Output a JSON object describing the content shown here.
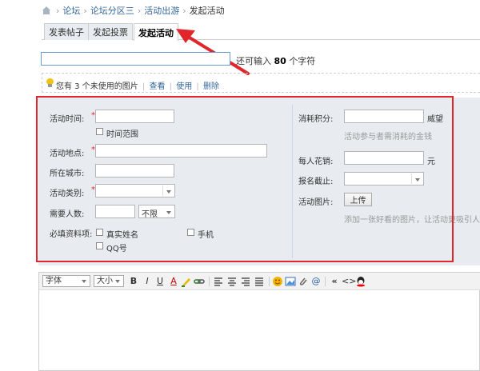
{
  "breadcrumb": [
    "论坛",
    "论坛分区三",
    "活动出游",
    "发起活动"
  ],
  "tabs": [
    "发表帖子",
    "发起投票",
    "发起活动"
  ],
  "subject": {
    "value": "",
    "remaining_prefix": "还可输入",
    "remaining_count": "80",
    "remaining_suffix": "个字符"
  },
  "attach": {
    "text": "您有 3 个未使用的图片",
    "view": "查看",
    "use": "使用",
    "delete": "删除"
  },
  "form": {
    "time_label": "活动时间:",
    "time_range": "时间范围",
    "place_label": "活动地点:",
    "city_label": "所在城市:",
    "category_label": "活动类别:",
    "people_label": "需要人数:",
    "people_limit": "不限",
    "required_label": "必填资料项:",
    "opt_realname": "真实姓名",
    "opt_phone": "手机",
    "opt_qq": "QQ号",
    "points_label": "消耗积分:",
    "points_unit": "威望",
    "points_hint": "活动参与者需消耗的金钱",
    "cost_label": "每人花销:",
    "cost_unit": "元",
    "deadline_label": "报名截止:",
    "image_label": "活动图片:",
    "upload_button": "上传",
    "image_hint": "添加一张好看的图片，让活动更吸引人"
  },
  "editor": {
    "font_select": "字体",
    "size_select": "大小",
    "buttons": {
      "bold": "B",
      "italic": "I",
      "underline": "U",
      "color": "A",
      "quote": "«",
      "code": "<>"
    }
  },
  "colors": {
    "highlight_border": "#e0262a",
    "panel_bg": "#e8ecf0"
  }
}
